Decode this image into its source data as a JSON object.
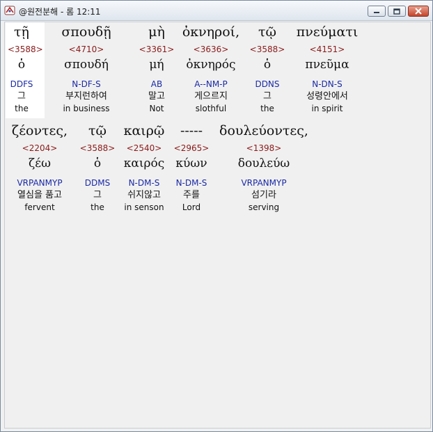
{
  "window": {
    "title": "@원전분해 - 롬 12:11",
    "buttons": {
      "minimize_icon": "minimize-icon",
      "maximize_icon": "maximize-icon",
      "close_icon": "close-icon"
    }
  },
  "rows": [
    {
      "words": [
        {
          "greek": "τῇ",
          "strong": "<3588>",
          "lemma": "ὁ",
          "parse": "DDFS",
          "korean": "그",
          "english": "the"
        },
        {
          "greek": "σπουδῇ",
          "strong": "<4710>",
          "lemma": "σπουδή",
          "parse": "N-DF-S",
          "korean": "부지런하여",
          "english": "in business"
        },
        {
          "greek": "μὴ",
          "strong": "<3361>",
          "lemma": "μή",
          "parse": "AB",
          "korean": "말고",
          "english": "Not"
        },
        {
          "greek": "ὀκνηροί,",
          "strong": "<3636>",
          "lemma": "ὀκνηρός",
          "parse": "A--NM-P",
          "korean": "게으르지",
          "english": "slothful"
        },
        {
          "greek": "τῷ",
          "strong": "<3588>",
          "lemma": "ὁ",
          "parse": "DDNS",
          "korean": "그",
          "english": "the"
        },
        {
          "greek": "πνεύματι",
          "strong": "<4151>",
          "lemma": "πνεῦμα",
          "parse": "N-DN-S",
          "korean": "성령안에서",
          "english": "in spirit"
        }
      ]
    },
    {
      "words": [
        {
          "greek": "ζέοντες,",
          "strong": "<2204>",
          "lemma": "ζέω",
          "parse": "VRPANMYP",
          "korean": "열심을 품고",
          "english": "fervent"
        },
        {
          "greek": "τῷ",
          "strong": "<3588>",
          "lemma": "ὁ",
          "parse": "DDMS",
          "korean": "그",
          "english": "the"
        },
        {
          "greek": "καιρῷ",
          "strong": "<2540>",
          "lemma": "καιρός",
          "parse": "N-DM-S",
          "korean": "쉬지않고",
          "english": "in senson"
        },
        {
          "greek": "-----",
          "strong": "<2965>",
          "lemma": "κύων",
          "parse": "N-DM-S",
          "korean": "주를",
          "english": "Lord"
        },
        {
          "greek": "δουλεύοντες,",
          "strong": "<1398>",
          "lemma": "δουλεύω",
          "parse": "VRPANMYP",
          "korean": "섬기라",
          "english": "serving"
        }
      ]
    }
  ]
}
